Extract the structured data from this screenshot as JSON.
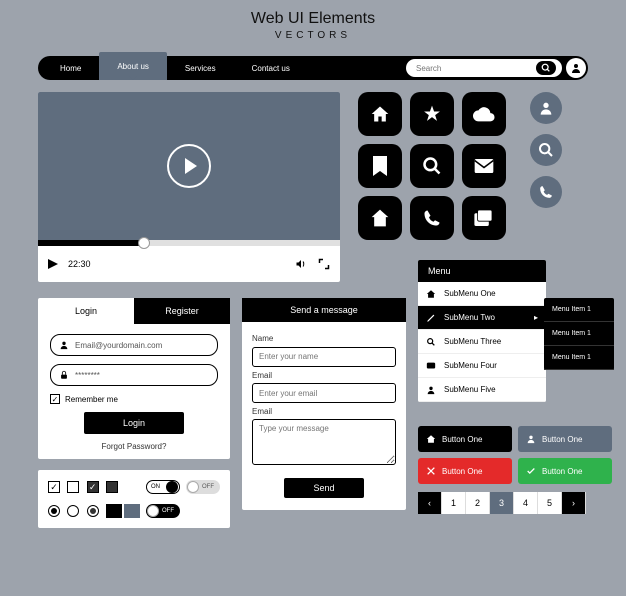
{
  "header": {
    "title": "Web UI Elements",
    "subtitle": "VECTORS"
  },
  "nav": {
    "items": [
      "Home",
      "About us",
      "Services",
      "Contact us"
    ],
    "active": 1,
    "search_placeholder": "Search"
  },
  "video": {
    "time": "22:30"
  },
  "auth": {
    "tab_login": "Login",
    "tab_register": "Register",
    "email_placeholder": "Email@yourdomain.com",
    "password_placeholder": "********",
    "remember": "Remember me",
    "login_btn": "Login",
    "forgot": "Forgot Password?"
  },
  "contact": {
    "title": "Send a message",
    "name_lbl": "Name",
    "name_ph": "Enter your name",
    "email_lbl": "Email",
    "email_ph": "Enter your email",
    "msg_lbl": "Email",
    "msg_ph": "Type your message",
    "send": "Send"
  },
  "menu": {
    "title": "Menu",
    "items": [
      "SubMenu One",
      "SubMenu Two",
      "SubMenu Three",
      "SubMenu Four",
      "SubMenu Five"
    ],
    "active": 1,
    "flyout": [
      "Menu Item 1",
      "Menu Item 1",
      "Menu Item 1"
    ]
  },
  "buttons": {
    "label": "Button One"
  },
  "pager": {
    "pages": [
      "1",
      "2",
      "3",
      "4",
      "5"
    ],
    "active": 2
  },
  "toggles": {
    "on": "ON",
    "off": "OFF"
  },
  "icons": {
    "grid": [
      "home-icon",
      "star-icon",
      "cloud-icon",
      "bookmark-icon",
      "search-icon",
      "mail-icon",
      "house-icon",
      "phone-icon",
      "windows-icon"
    ],
    "circles": [
      "person-icon",
      "search-icon",
      "phone-icon"
    ]
  }
}
